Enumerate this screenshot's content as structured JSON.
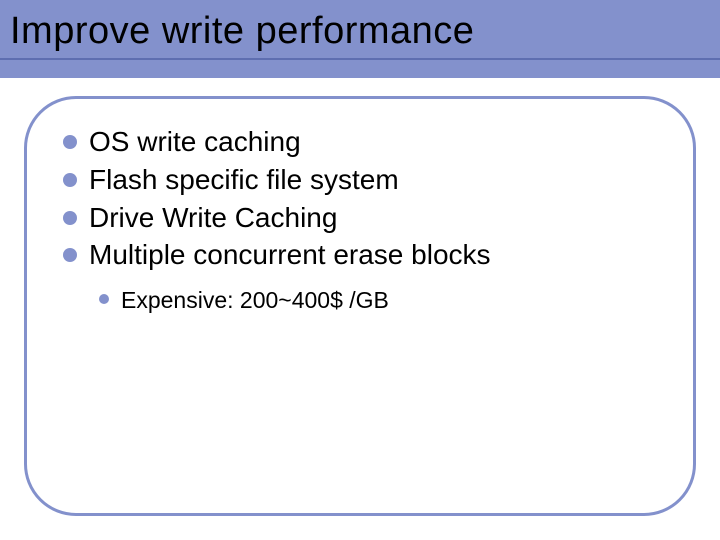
{
  "title": "Improve write performance",
  "bullets": [
    {
      "text": "OS write caching"
    },
    {
      "text": "Flash specific file system"
    },
    {
      "text": "Drive Write Caching"
    },
    {
      "text": "Multiple concurrent erase blocks"
    }
  ],
  "sub_bullets": [
    {
      "text": "Expensive: 200~400$ /GB"
    }
  ]
}
